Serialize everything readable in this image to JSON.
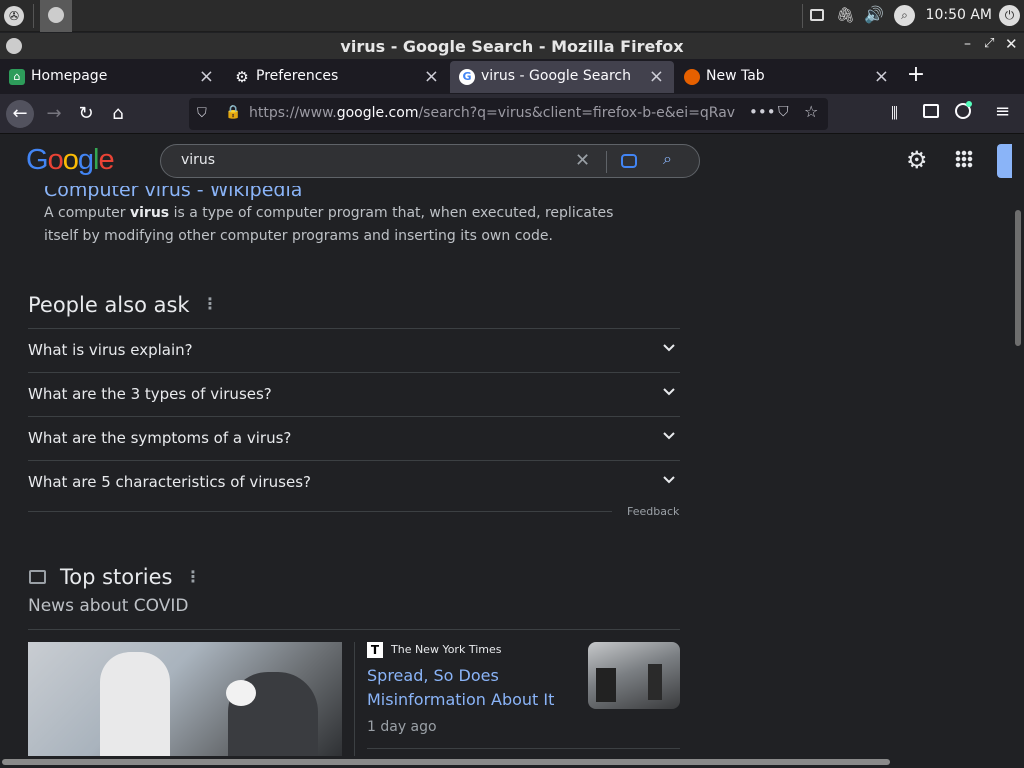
{
  "system": {
    "clock": "10:50 AM"
  },
  "window": {
    "title": "virus - Google Search - Mozilla Firefox"
  },
  "tabs": [
    {
      "label": "Homepage",
      "icon": "app-icon"
    },
    {
      "label": "Preferences",
      "icon": "gear-icon"
    },
    {
      "label": "virus - Google Search",
      "icon": "google-icon",
      "active": true
    },
    {
      "label": "New Tab",
      "icon": "firefox-icon"
    }
  ],
  "navbar": {
    "url_prefix": "https://www.",
    "url_host": "google.com",
    "url_rest": "/search?q=virus&client=firefox-b-e&ei=qRav"
  },
  "google": {
    "logo": "Google",
    "search_value": "virus"
  },
  "result": {
    "title": "Computer virus - Wikipedia",
    "snippet_before": "A computer ",
    "snippet_bold": "virus",
    "snippet_after": " is a type of computer program that, when executed, replicates itself by modifying other computer programs and inserting its own code."
  },
  "people_also_ask": {
    "heading": "People also ask",
    "questions": [
      "What is virus explain?",
      "What are the 3 types of viruses?",
      "What are the symptoms of a virus?",
      "What are 5 characteristics of viruses?"
    ],
    "feedback": "Feedback"
  },
  "top_stories": {
    "heading": "Top stories",
    "subheading": "News about COVID",
    "story": {
      "source": "The New York Times",
      "title_line1": "Spread, So Does",
      "title_line2": "Misinformation About It",
      "time": "1 day ago"
    }
  }
}
